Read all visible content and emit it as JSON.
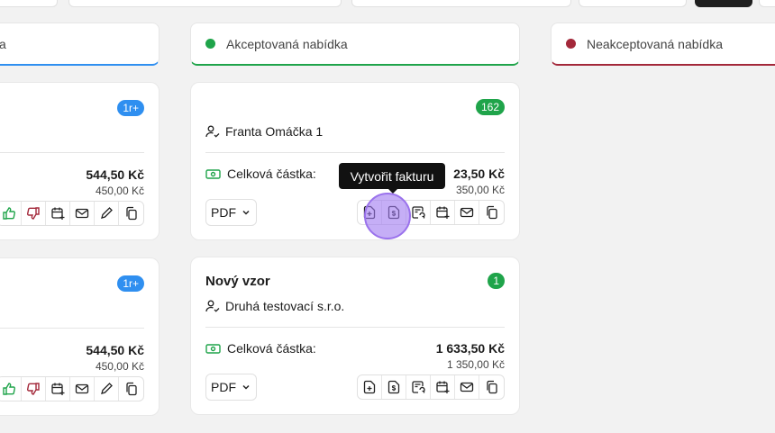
{
  "columns": [
    {
      "title": "a",
      "accent": "#2f8ff0"
    },
    {
      "title": "Akceptovaná nabídka",
      "accent": "#1fa44a"
    },
    {
      "title": "Neakceptovaná nabídka",
      "accent": "#a3283a"
    }
  ],
  "left_cards": [
    {
      "badge": "1r+",
      "amount": "544,50 Kč",
      "amount_sub": "450,00 Kč"
    },
    {
      "badge": "1r+",
      "amount": "544,50 Kč",
      "amount_sub": "450,00 Kč"
    }
  ],
  "accepted_cards": [
    {
      "badge": "162",
      "title": "",
      "customer": "Franta Omáčka 1",
      "total_label": "Celková částka:",
      "amount": "23,50 Kč",
      "amount_sub": "350,00 Kč",
      "pdf_label": "PDF"
    },
    {
      "badge": "1",
      "title": "Nový vzor",
      "customer": "Druhá testovací s.r.o.",
      "total_label": "Celková částka:",
      "amount": "1 633,50 Kč",
      "amount_sub": "1 350,00 Kč",
      "pdf_label": "PDF"
    }
  ],
  "tooltip": "Vytvořit fakturu",
  "icons": [
    "user-check-icon",
    "money-icon",
    "chevron-down-icon",
    "file-plus-icon",
    "invoice-icon",
    "receipt-refresh-icon",
    "calendar-plus-icon",
    "mail-icon",
    "copy-icon",
    "thumbs-up-icon",
    "thumbs-down-icon",
    "pencil-icon"
  ],
  "colors": {
    "accepted": "#1fa44a",
    "rejected": "#a3283a",
    "info": "#2f8ff0",
    "cursor": "#9a72ec"
  }
}
